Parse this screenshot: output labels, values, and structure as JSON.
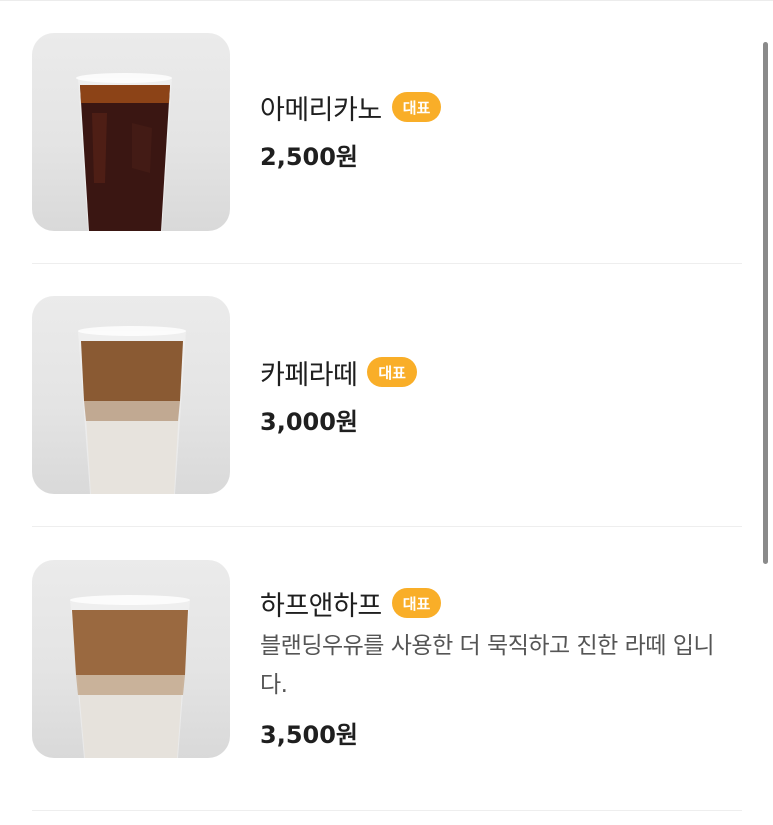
{
  "menu": {
    "items": [
      {
        "name": "아메리카노",
        "badge": "대표",
        "description": "",
        "price": "2,500원",
        "drink": "americano"
      },
      {
        "name": "카페라떼",
        "badge": "대표",
        "description": "",
        "price": "3,000원",
        "drink": "latte"
      },
      {
        "name": "하프앤하프",
        "badge": "대표",
        "description": "블랜딩우유를 사용한 더 묵직하고 진한 라떼 입니다.",
        "price": "3,500원",
        "drink": "half-and-half"
      }
    ]
  },
  "colors": {
    "badge": "#f9ae28",
    "americano": "#2f1010",
    "latte_top": "#7a4a25",
    "milk": "#e9e6e1"
  }
}
